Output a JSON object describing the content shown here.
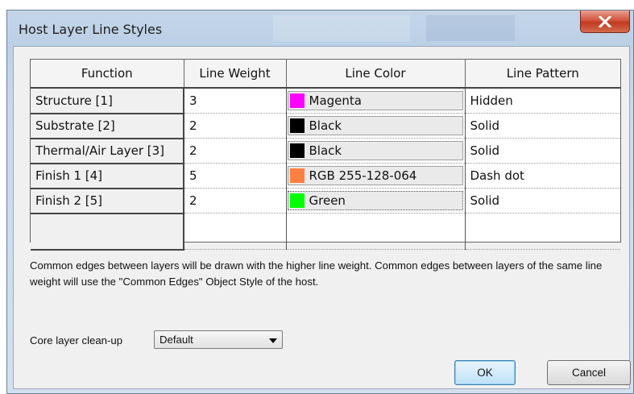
{
  "window": {
    "title": "Host Layer Line Styles"
  },
  "grid": {
    "headers": [
      "Function",
      "Line Weight",
      "Line Color",
      "Line Pattern"
    ],
    "rows": [
      {
        "function": "Structure [1]",
        "weight": "3",
        "color_name": "Magenta",
        "swatch": "#ff00ff",
        "pattern": "Hidden"
      },
      {
        "function": "Substrate [2]",
        "weight": "2",
        "color_name": "Black",
        "swatch": "#000000",
        "pattern": "Solid"
      },
      {
        "function": "Thermal/Air Layer [3]",
        "weight": "2",
        "color_name": "Black",
        "swatch": "#000000",
        "pattern": "Solid"
      },
      {
        "function": "Finish 1 [4]",
        "weight": "5",
        "color_name": "RGB 255-128-064",
        "swatch": "#ff8040",
        "pattern": "Dash dot"
      },
      {
        "function": "Finish 2 [5]",
        "weight": "2",
        "color_name": "Green",
        "swatch": "#00ff00",
        "pattern": "Solid"
      }
    ]
  },
  "note": "Common edges between layers will be drawn with the higher line weight.  Common edges between layers of the same line weight will use the \"Common Edges\" Object Style of the host.",
  "core_cleanup": {
    "label": "Core layer clean-up",
    "value": "Default"
  },
  "buttons": {
    "ok": "OK",
    "cancel": "Cancel"
  },
  "icons": {
    "close": "close-icon",
    "dropdown": "chevron-down-icon"
  },
  "colors": {
    "close_button": "#c8452c",
    "ok_border": "#3c7fb1"
  }
}
